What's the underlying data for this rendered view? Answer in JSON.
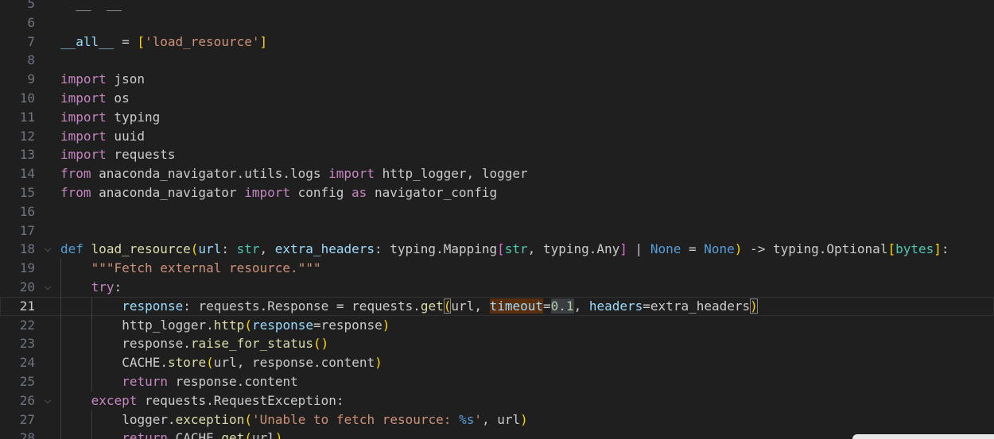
{
  "editor": {
    "language": "python",
    "active_line": 21,
    "lines": [
      {
        "num": "5",
        "fold": "",
        "indent": 0,
        "tokens": [
          {
            "t": "  __  __  ",
            "c": "t-plain"
          }
        ]
      },
      {
        "num": "6",
        "fold": "",
        "indent": 0,
        "tokens": []
      },
      {
        "num": "7",
        "fold": "",
        "indent": 0,
        "tokens": [
          {
            "t": "__all__",
            "c": "t-param"
          },
          {
            "t": " = ",
            "c": "t-plain"
          },
          {
            "t": "[",
            "c": "t-b1"
          },
          {
            "t": "'load_resource'",
            "c": "t-str"
          },
          {
            "t": "]",
            "c": "t-b1"
          }
        ]
      },
      {
        "num": "8",
        "fold": "",
        "indent": 0,
        "tokens": []
      },
      {
        "num": "9",
        "fold": "",
        "indent": 0,
        "tokens": [
          {
            "t": "import",
            "c": "t-kw"
          },
          {
            "t": " json",
            "c": "t-plain"
          }
        ]
      },
      {
        "num": "10",
        "fold": "",
        "indent": 0,
        "tokens": [
          {
            "t": "import",
            "c": "t-kw"
          },
          {
            "t": " os",
            "c": "t-plain"
          }
        ]
      },
      {
        "num": "11",
        "fold": "",
        "indent": 0,
        "tokens": [
          {
            "t": "import",
            "c": "t-kw"
          },
          {
            "t": " typing",
            "c": "t-plain"
          }
        ]
      },
      {
        "num": "12",
        "fold": "",
        "indent": 0,
        "tokens": [
          {
            "t": "import",
            "c": "t-kw"
          },
          {
            "t": " uuid",
            "c": "t-plain"
          }
        ]
      },
      {
        "num": "13",
        "fold": "",
        "indent": 0,
        "tokens": [
          {
            "t": "import",
            "c": "t-kw"
          },
          {
            "t": " requests",
            "c": "t-plain"
          }
        ]
      },
      {
        "num": "14",
        "fold": "",
        "indent": 0,
        "tokens": [
          {
            "t": "from",
            "c": "t-kw"
          },
          {
            "t": " anaconda_navigator.utils.logs ",
            "c": "t-plain"
          },
          {
            "t": "import",
            "c": "t-kw"
          },
          {
            "t": " http_logger, logger",
            "c": "t-plain"
          }
        ]
      },
      {
        "num": "15",
        "fold": "",
        "indent": 0,
        "tokens": [
          {
            "t": "from",
            "c": "t-kw"
          },
          {
            "t": " anaconda_navigator ",
            "c": "t-plain"
          },
          {
            "t": "import",
            "c": "t-kw"
          },
          {
            "t": " config ",
            "c": "t-plain"
          },
          {
            "t": "as",
            "c": "t-kw"
          },
          {
            "t": " navigator_config",
            "c": "t-plain"
          }
        ]
      },
      {
        "num": "16",
        "fold": "",
        "indent": 0,
        "tokens": []
      },
      {
        "num": "17",
        "fold": "",
        "indent": 0,
        "tokens": []
      },
      {
        "num": "18",
        "fold": "⌵",
        "indent": 0,
        "tokens": [
          {
            "t": "def",
            "c": "t-def"
          },
          {
            "t": " ",
            "c": "t-plain"
          },
          {
            "t": "load_resource",
            "c": "t-fn"
          },
          {
            "t": "(",
            "c": "t-b1"
          },
          {
            "t": "url",
            "c": "t-param"
          },
          {
            "t": ": ",
            "c": "t-plain"
          },
          {
            "t": "str",
            "c": "t-type"
          },
          {
            "t": ", ",
            "c": "t-plain"
          },
          {
            "t": "extra_headers",
            "c": "t-param"
          },
          {
            "t": ": typing.Mapping",
            "c": "t-plain"
          },
          {
            "t": "[",
            "c": "t-b2"
          },
          {
            "t": "str",
            "c": "t-type"
          },
          {
            "t": ", typing.Any",
            "c": "t-plain"
          },
          {
            "t": "]",
            "c": "t-b2"
          },
          {
            "t": " | ",
            "c": "t-plain"
          },
          {
            "t": "None",
            "c": "t-const"
          },
          {
            "t": " = ",
            "c": "t-plain"
          },
          {
            "t": "None",
            "c": "t-const"
          },
          {
            "t": ")",
            "c": "t-b1"
          },
          {
            "t": " -> typing.Optional",
            "c": "t-plain"
          },
          {
            "t": "[",
            "c": "t-b1"
          },
          {
            "t": "bytes",
            "c": "t-type"
          },
          {
            "t": "]",
            "c": "t-b1"
          },
          {
            "t": ":",
            "c": "t-plain"
          }
        ]
      },
      {
        "num": "19",
        "fold": "",
        "indent": 1,
        "tokens": [
          {
            "t": "\"\"\"Fetch external resource.\"\"\"",
            "c": "t-str"
          }
        ]
      },
      {
        "num": "20",
        "fold": "⌵",
        "indent": 1,
        "tokens": [
          {
            "t": "try",
            "c": "t-kw"
          },
          {
            "t": ":",
            "c": "t-plain"
          }
        ]
      },
      {
        "num": "21",
        "fold": "",
        "indent": 2,
        "tokens": [
          {
            "t": "response",
            "c": "t-param"
          },
          {
            "t": ": requests.Response = requests.",
            "c": "t-plain"
          },
          {
            "t": "get",
            "c": "t-fn"
          },
          {
            "t": "(",
            "c": "t-bm"
          },
          {
            "t": "url",
            "c": "t-plain"
          },
          {
            "t": ", ",
            "c": "t-plain"
          },
          {
            "t": "timeout",
            "c": "t-hl"
          },
          {
            "t": "=",
            "c": "t-plain"
          },
          {
            "t": "0.1",
            "c": "t-hlnum"
          },
          {
            "t": ", ",
            "c": "t-plain"
          },
          {
            "t": "headers",
            "c": "t-param"
          },
          {
            "t": "=extra_headers",
            "c": "t-plain"
          },
          {
            "t": ")",
            "c": "t-bm"
          }
        ]
      },
      {
        "num": "22",
        "fold": "",
        "indent": 2,
        "tokens": [
          {
            "t": "http_logger.",
            "c": "t-plain"
          },
          {
            "t": "http",
            "c": "t-fn"
          },
          {
            "t": "(",
            "c": "t-b1"
          },
          {
            "t": "response",
            "c": "t-param"
          },
          {
            "t": "=response",
            "c": "t-plain"
          },
          {
            "t": ")",
            "c": "t-b1"
          }
        ]
      },
      {
        "num": "23",
        "fold": "",
        "indent": 2,
        "tokens": [
          {
            "t": "response.",
            "c": "t-plain"
          },
          {
            "t": "raise_for_status",
            "c": "t-fn"
          },
          {
            "t": "()",
            "c": "t-b1"
          }
        ]
      },
      {
        "num": "24",
        "fold": "",
        "indent": 2,
        "tokens": [
          {
            "t": "CACHE.",
            "c": "t-plain"
          },
          {
            "t": "store",
            "c": "t-fn"
          },
          {
            "t": "(",
            "c": "t-b1"
          },
          {
            "t": "url, response.content",
            "c": "t-plain"
          },
          {
            "t": ")",
            "c": "t-b1"
          }
        ]
      },
      {
        "num": "25",
        "fold": "",
        "indent": 2,
        "tokens": [
          {
            "t": "return",
            "c": "t-kw"
          },
          {
            "t": " response.content",
            "c": "t-plain"
          }
        ]
      },
      {
        "num": "26",
        "fold": "⌵",
        "indent": 1,
        "tokens": [
          {
            "t": "except",
            "c": "t-kw"
          },
          {
            "t": " requests.RequestException:",
            "c": "t-plain"
          }
        ]
      },
      {
        "num": "27",
        "fold": "",
        "indent": 2,
        "tokens": [
          {
            "t": "logger.",
            "c": "t-plain"
          },
          {
            "t": "exception",
            "c": "t-fn"
          },
          {
            "t": "(",
            "c": "t-b1"
          },
          {
            "t": "'Unable to fetch resource: ",
            "c": "t-str"
          },
          {
            "t": "%s",
            "c": "t-fmt"
          },
          {
            "t": "'",
            "c": "t-str"
          },
          {
            "t": ", url",
            "c": "t-plain"
          },
          {
            "t": ")",
            "c": "t-b1"
          }
        ]
      },
      {
        "num": "28",
        "fold": "",
        "indent": 2,
        "tokens": [
          {
            "t": "return",
            "c": "t-kw"
          },
          {
            "t": " CACHE.",
            "c": "t-plain"
          },
          {
            "t": "get",
            "c": "t-fn"
          },
          {
            "t": "(",
            "c": "t-b1"
          },
          {
            "t": "url",
            "c": "t-plain"
          },
          {
            "t": ")",
            "c": "t-b1"
          }
        ]
      }
    ]
  }
}
